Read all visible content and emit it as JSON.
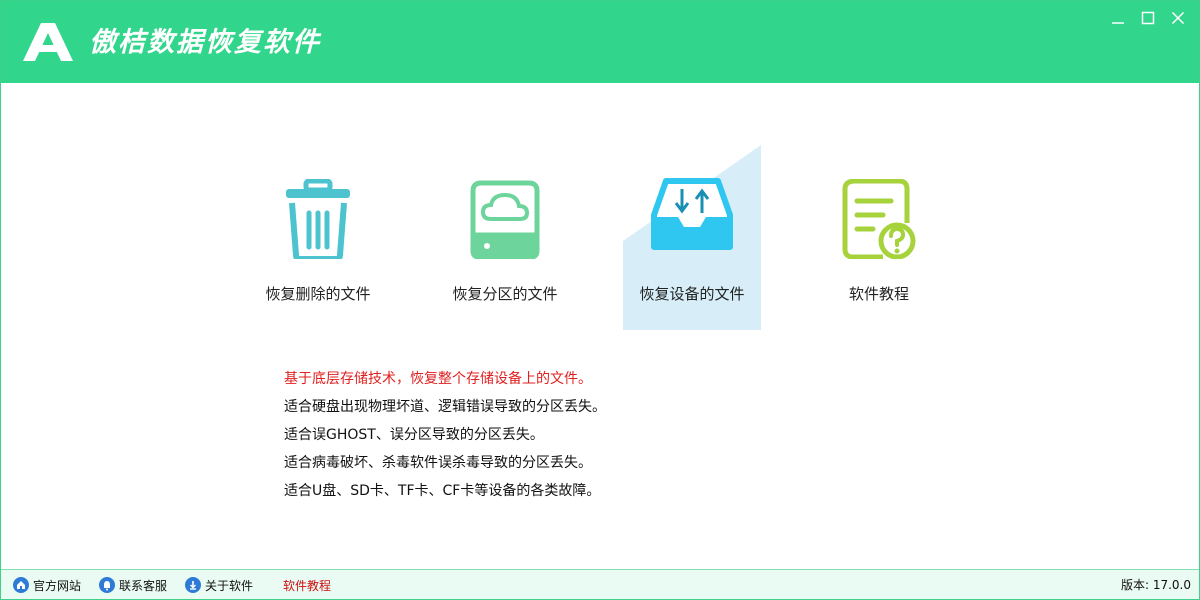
{
  "window": {
    "title": "傲桔数据恢复软件",
    "accent": "#31d58b"
  },
  "tiles": [
    {
      "label": "恢复删除的文件",
      "icon": "trash-icon",
      "color": "#4cc3cf"
    },
    {
      "label": "恢复分区的文件",
      "icon": "hard-drive-cloud-icon",
      "color": "#6dd49b"
    },
    {
      "label": "恢复设备的文件",
      "icon": "device-tray-icon",
      "color": "#2fc6f0",
      "selected": true
    },
    {
      "label": "软件教程",
      "icon": "document-help-icon",
      "color": "#a6d23c"
    }
  ],
  "description": {
    "lines": [
      "基于底层存储技术，恢复整个存储设备上的文件。",
      "适合硬盘出现物理坏道、逻辑错误导致的分区丢失。",
      "适合误GHOST、误分区导致的分区丢失。",
      "适合病毒破坏、杀毒软件误杀毒导致的分区丢失。",
      "适合U盘、SD卡、TF卡、CF卡等设备的各类故障。"
    ]
  },
  "statusbar": {
    "official_site": "官方网站",
    "contact_service": "联系客服",
    "about_software": "关于软件",
    "tutorial": "软件教程",
    "version": "版本: 17.0.0"
  }
}
